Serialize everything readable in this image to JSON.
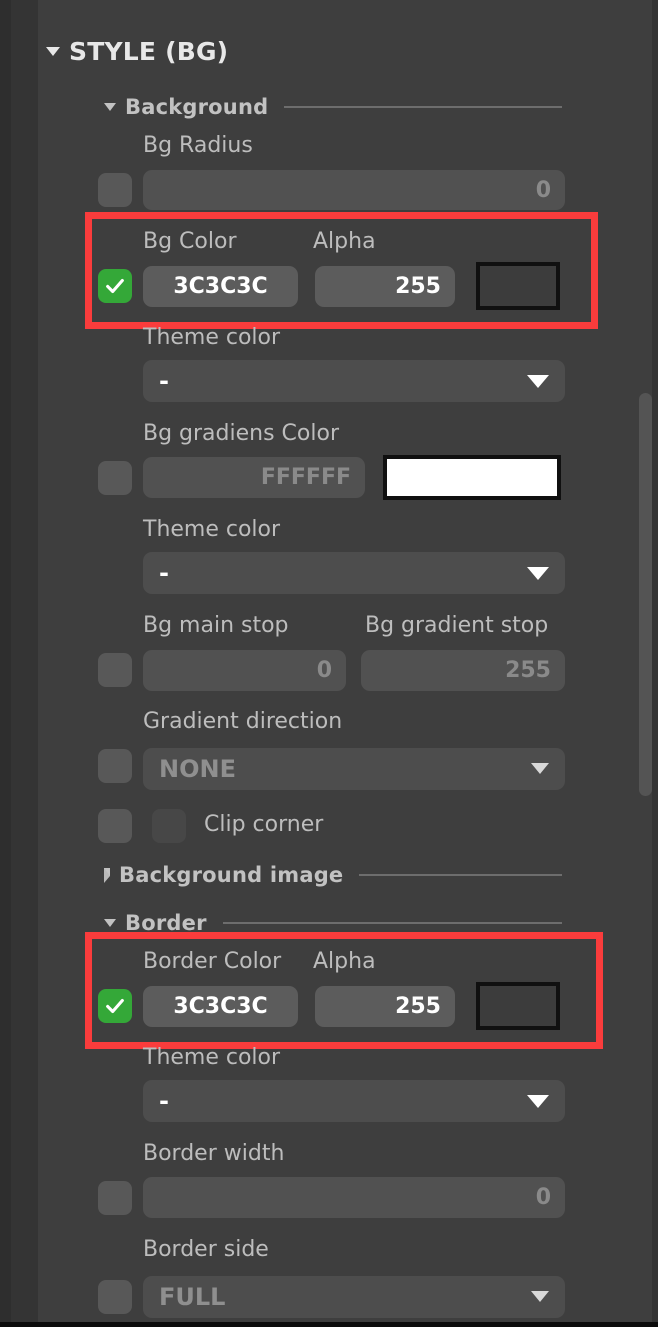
{
  "panel": {
    "title": "STYLE (BG)",
    "sections": {
      "background": "Background",
      "background_image": "Background image",
      "border": "Border"
    }
  },
  "fields": {
    "bg_radius": {
      "label": "Bg Radius",
      "value": "0"
    },
    "bg_color": {
      "label": "Bg Color",
      "value": "3C3C3C",
      "swatch": "#3C3C3C"
    },
    "bg_color_alpha": {
      "label": "Alpha",
      "value": "255"
    },
    "bg_theme_color": {
      "label": "Theme color",
      "value": "-"
    },
    "bg_gradiens_color": {
      "label": "Bg gradiens Color",
      "value": "FFFFFF",
      "swatch": "#FFFFFF"
    },
    "bg_gradiens_theme_color": {
      "label": "Theme color",
      "value": "-"
    },
    "bg_main_stop": {
      "label": "Bg main stop",
      "value": "0"
    },
    "bg_gradient_stop": {
      "label": "Bg gradient stop",
      "value": "255"
    },
    "gradient_direction": {
      "label": "Gradient direction",
      "value": "NONE"
    },
    "clip_corner": {
      "label": "Clip corner"
    },
    "border_color": {
      "label": "Border Color",
      "value": "3C3C3C",
      "swatch": "#3C3C3C"
    },
    "border_color_alpha": {
      "label": "Alpha",
      "value": "255"
    },
    "border_theme_color": {
      "label": "Theme color",
      "value": "-"
    },
    "border_width": {
      "label": "Border width",
      "value": "0"
    },
    "border_side": {
      "label": "Border side",
      "value": "FULL"
    }
  },
  "colors": {
    "highlight": "#FA3C3C",
    "checkbox_on": "#34A838",
    "panel_bg": "#3E3E3E",
    "field_bg": "#565656"
  }
}
